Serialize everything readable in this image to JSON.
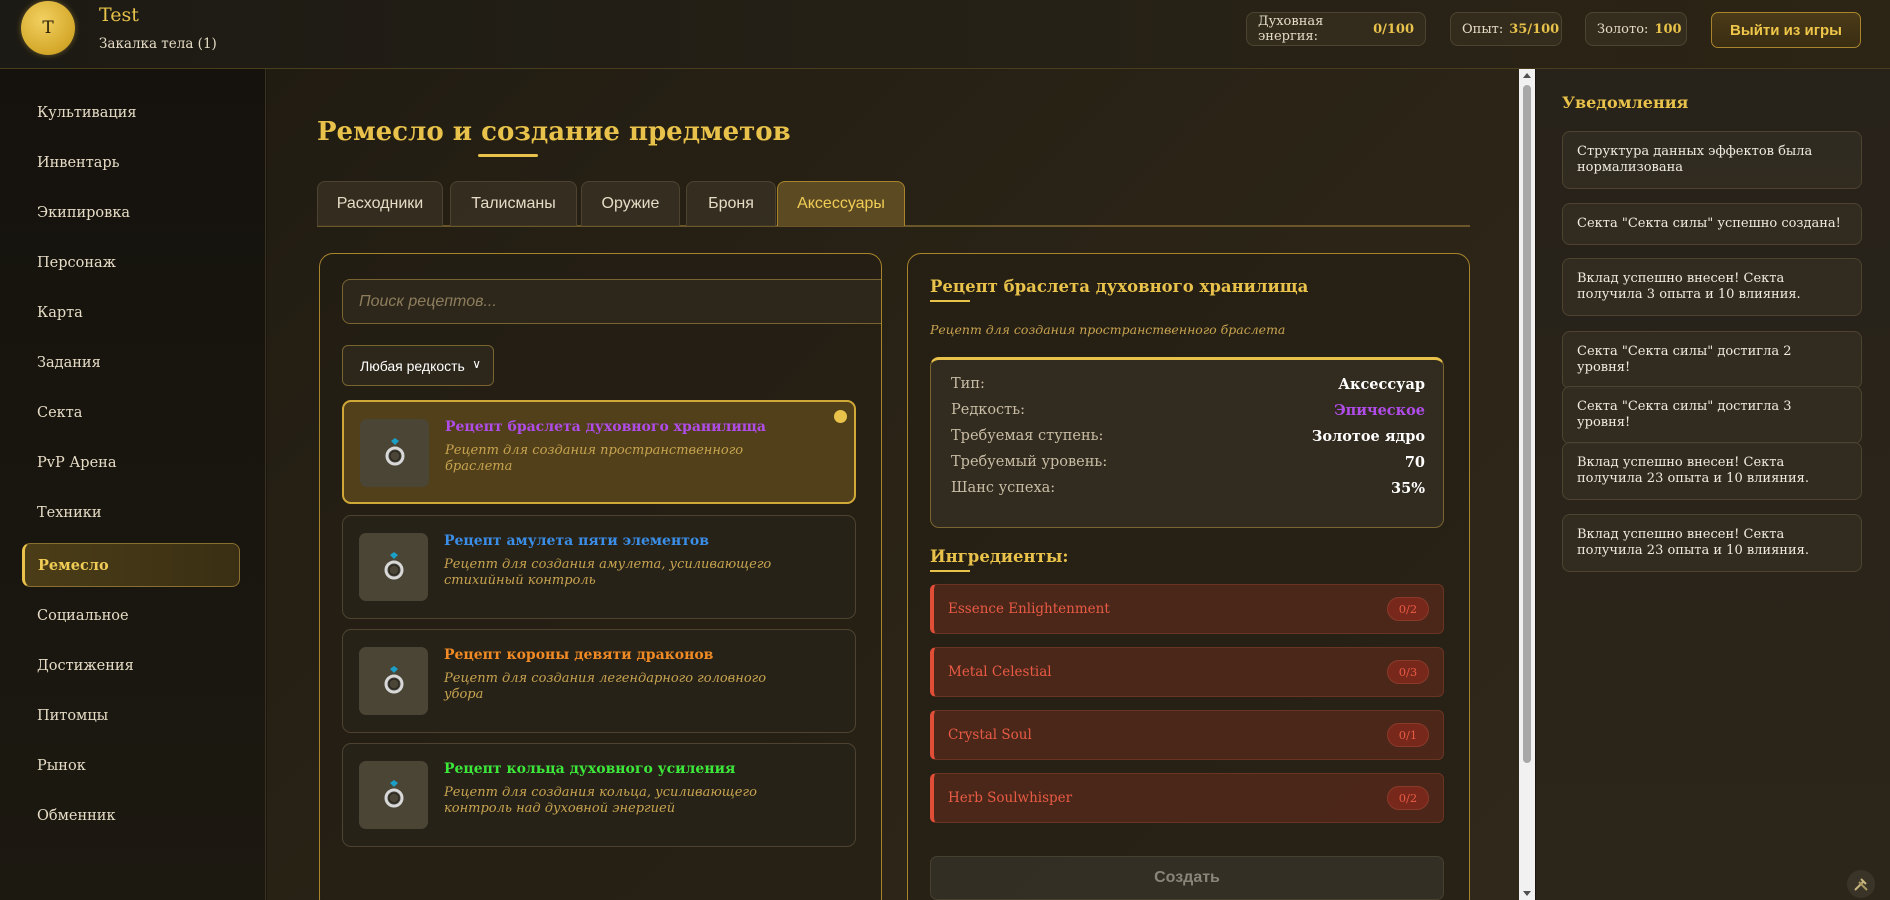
{
  "header": {
    "avatar_letter": "T",
    "player_name": "Test",
    "realm": "Закалка тела (1)",
    "stats": [
      {
        "label": "Духовная энергия:",
        "value": "0/100"
      },
      {
        "label": "Опыт:",
        "value": "35/100"
      },
      {
        "label": "Золото:",
        "value": "100"
      }
    ],
    "logout_label": "Выйти из игры"
  },
  "sidebar": {
    "items": [
      {
        "label": "Культивация"
      },
      {
        "label": "Инвентарь"
      },
      {
        "label": "Экипировка"
      },
      {
        "label": "Персонаж"
      },
      {
        "label": "Карта"
      },
      {
        "label": "Задания"
      },
      {
        "label": "Секта"
      },
      {
        "label": "PvP Арена"
      },
      {
        "label": "Техники"
      },
      {
        "label": "Ремесло",
        "active": true
      },
      {
        "label": "Социальное"
      },
      {
        "label": "Достижения"
      },
      {
        "label": "Питомцы"
      },
      {
        "label": "Рынок"
      },
      {
        "label": "Обменник"
      }
    ]
  },
  "main": {
    "title": "Ремесло и создание предметов",
    "tabs": [
      {
        "label": "Расходники"
      },
      {
        "label": "Талисманы"
      },
      {
        "label": "Оружие"
      },
      {
        "label": "Броня"
      },
      {
        "label": "Аксессуары",
        "active": true
      }
    ],
    "search": {
      "placeholder": "Поиск рецептов...",
      "value": ""
    },
    "rarity_filter": {
      "selected": "Любая редкость"
    },
    "recipes": [
      {
        "name": "Рецепт браслета духовного хранилища",
        "description": "Рецепт для создания пространственного браслета",
        "color": "#b04ce8",
        "selected": true,
        "icon": "ring-icon"
      },
      {
        "name": "Рецепт амулета пяти элементов",
        "description": "Рецепт для создания амулета, усиливающего стихийный контроль",
        "color": "#3a8ee8",
        "selected": false,
        "icon": "ring-icon"
      },
      {
        "name": "Рецепт короны девяти драконов",
        "description": "Рецепт для создания легендарного головного убора",
        "color": "#f08a24",
        "selected": false,
        "icon": "ring-icon"
      },
      {
        "name": "Рецепт кольца духовного усиления",
        "description": "Рецепт для создания кольца, усиливающего контроль над духовной энергией",
        "color": "#3ce83a",
        "selected": false,
        "icon": "ring-icon"
      }
    ],
    "detail": {
      "title": "Рецепт браслета духовного хранилища",
      "description": "Рецепт для создания пространственного браслета",
      "stats": [
        {
          "label": "Тип:",
          "value": "Аксессуар",
          "color": "#ffffff"
        },
        {
          "label": "Редкость:",
          "value": "Эпическое",
          "color": "#b04ce8"
        },
        {
          "label": "Требуемая ступень:",
          "value": "Золотое ядро",
          "color": "#ffffff"
        },
        {
          "label": "Требуемый уровень:",
          "value": "70",
          "color": "#ffffff"
        },
        {
          "label": "Шанс успеха:",
          "value": "35%",
          "color": "#ffffff"
        }
      ],
      "ingredients_title": "Ингредиенты:",
      "ingredients": [
        {
          "name": "Essence Enlightenment",
          "count": "0/2"
        },
        {
          "name": "Metal Celestial",
          "count": "0/3"
        },
        {
          "name": "Crystal Soul",
          "count": "0/1"
        },
        {
          "name": "Herb Soulwhisper",
          "count": "0/2"
        }
      ],
      "create_label": "Создать"
    }
  },
  "notifications": {
    "title": "Уведомления",
    "items": [
      "Структура данных эффектов была нормализована",
      "Секта \"Секта силы\" успешно создана!",
      "Вклад успешно внесен! Секта получила 3 опыта и 10 влияния.",
      "Секта \"Секта силы\" достигла 2 уровня!",
      "Секта \"Секта силы\" достигла 3 уровня!",
      "Вклад успешно внесен! Секта получила 23 опыта и 10 влияния.",
      "Вклад успешно внесен! Секта получила 23 опыта и 10 влияния."
    ]
  }
}
